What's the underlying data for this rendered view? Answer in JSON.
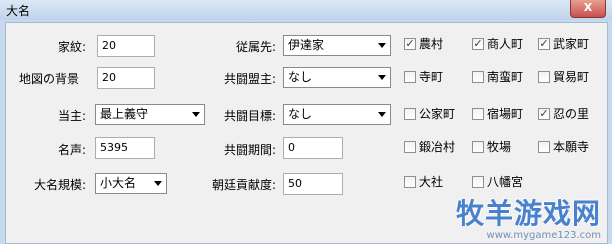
{
  "window": {
    "title": "大名",
    "close_label": "X"
  },
  "left_fields": [
    {
      "label": "家紋:",
      "value": "20",
      "kind": "input"
    },
    {
      "label": "地図の背景",
      "value": "20",
      "kind": "input"
    },
    {
      "label": "当主:",
      "value": "最上義守",
      "kind": "select"
    },
    {
      "label": "名声:",
      "value": "5395",
      "kind": "input"
    },
    {
      "label": "大名規模:",
      "value": "小大名",
      "kind": "select"
    }
  ],
  "middle_fields": [
    {
      "label": "従属先:",
      "value": "伊達家",
      "kind": "select"
    },
    {
      "label": "共闘盟主:",
      "value": "なし",
      "kind": "select"
    },
    {
      "label": "共闘目標:",
      "value": "なし",
      "kind": "select"
    },
    {
      "label": "共闘期間:",
      "value": "0",
      "kind": "input"
    },
    {
      "label": "朝廷貢献度:",
      "value": "50",
      "kind": "input"
    }
  ],
  "checkboxes": [
    {
      "label": "農村",
      "checked": true
    },
    {
      "label": "商人町",
      "checked": true
    },
    {
      "label": "武家町",
      "checked": true
    },
    {
      "label": "寺町",
      "checked": false
    },
    {
      "label": "南蛮町",
      "checked": false
    },
    {
      "label": "貿易町",
      "checked": false
    },
    {
      "label": "公家町",
      "checked": false
    },
    {
      "label": "宿場町",
      "checked": false
    },
    {
      "label": "忍の里",
      "checked": true
    },
    {
      "label": "鍛冶村",
      "checked": false
    },
    {
      "label": "牧場",
      "checked": false
    },
    {
      "label": "本願寺",
      "checked": false
    },
    {
      "label": "大社",
      "checked": false
    },
    {
      "label": "八幡宮",
      "checked": false
    }
  ],
  "watermark": {
    "text": "牧羊游戏网",
    "url": "www.mygame123.com"
  }
}
